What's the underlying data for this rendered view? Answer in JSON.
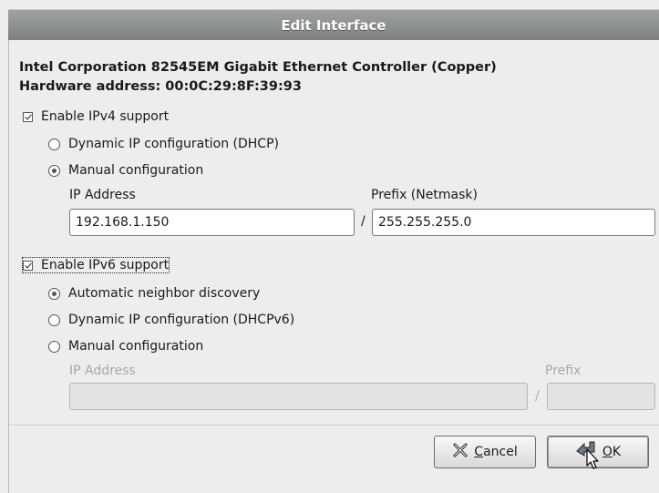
{
  "window": {
    "title": "Edit Interface"
  },
  "device": {
    "name": "Intel Corporation 82545EM Gigabit Ethernet Controller (Copper)",
    "hardware_address": "Hardware address: 00:0C:29:8F:39:93"
  },
  "ipv4": {
    "enable_label": "Enable IPv4 support",
    "enabled": true,
    "options": [
      {
        "label": "Dynamic IP configuration (DHCP)",
        "selected": false
      },
      {
        "label": "Manual configuration",
        "selected": true
      }
    ],
    "ip_label": "IP Address",
    "ip_value": "192.168.1.150",
    "separator": "/",
    "prefix_label": "Prefix (Netmask)",
    "prefix_value": "255.255.255.0"
  },
  "ipv6": {
    "enable_label": "Enable IPv6 support",
    "enabled": true,
    "options": [
      {
        "label": "Automatic neighbor discovery",
        "selected": true
      },
      {
        "label": "Dynamic IP configuration (DHCPv6)",
        "selected": false
      },
      {
        "label": "Manual configuration",
        "selected": false
      }
    ],
    "ip_label": "IP Address",
    "ip_value": "",
    "separator": "/",
    "prefix_label": "Prefix",
    "prefix_value": ""
  },
  "buttons": {
    "cancel": {
      "mnemonic": "C",
      "rest": "ancel",
      "icon": "cancel-x-icon"
    },
    "ok": {
      "mnemonic": "O",
      "rest": "K",
      "icon": "ok-arrow-icon"
    }
  },
  "cursor": {
    "icon": "mouse-pointer-icon"
  }
}
